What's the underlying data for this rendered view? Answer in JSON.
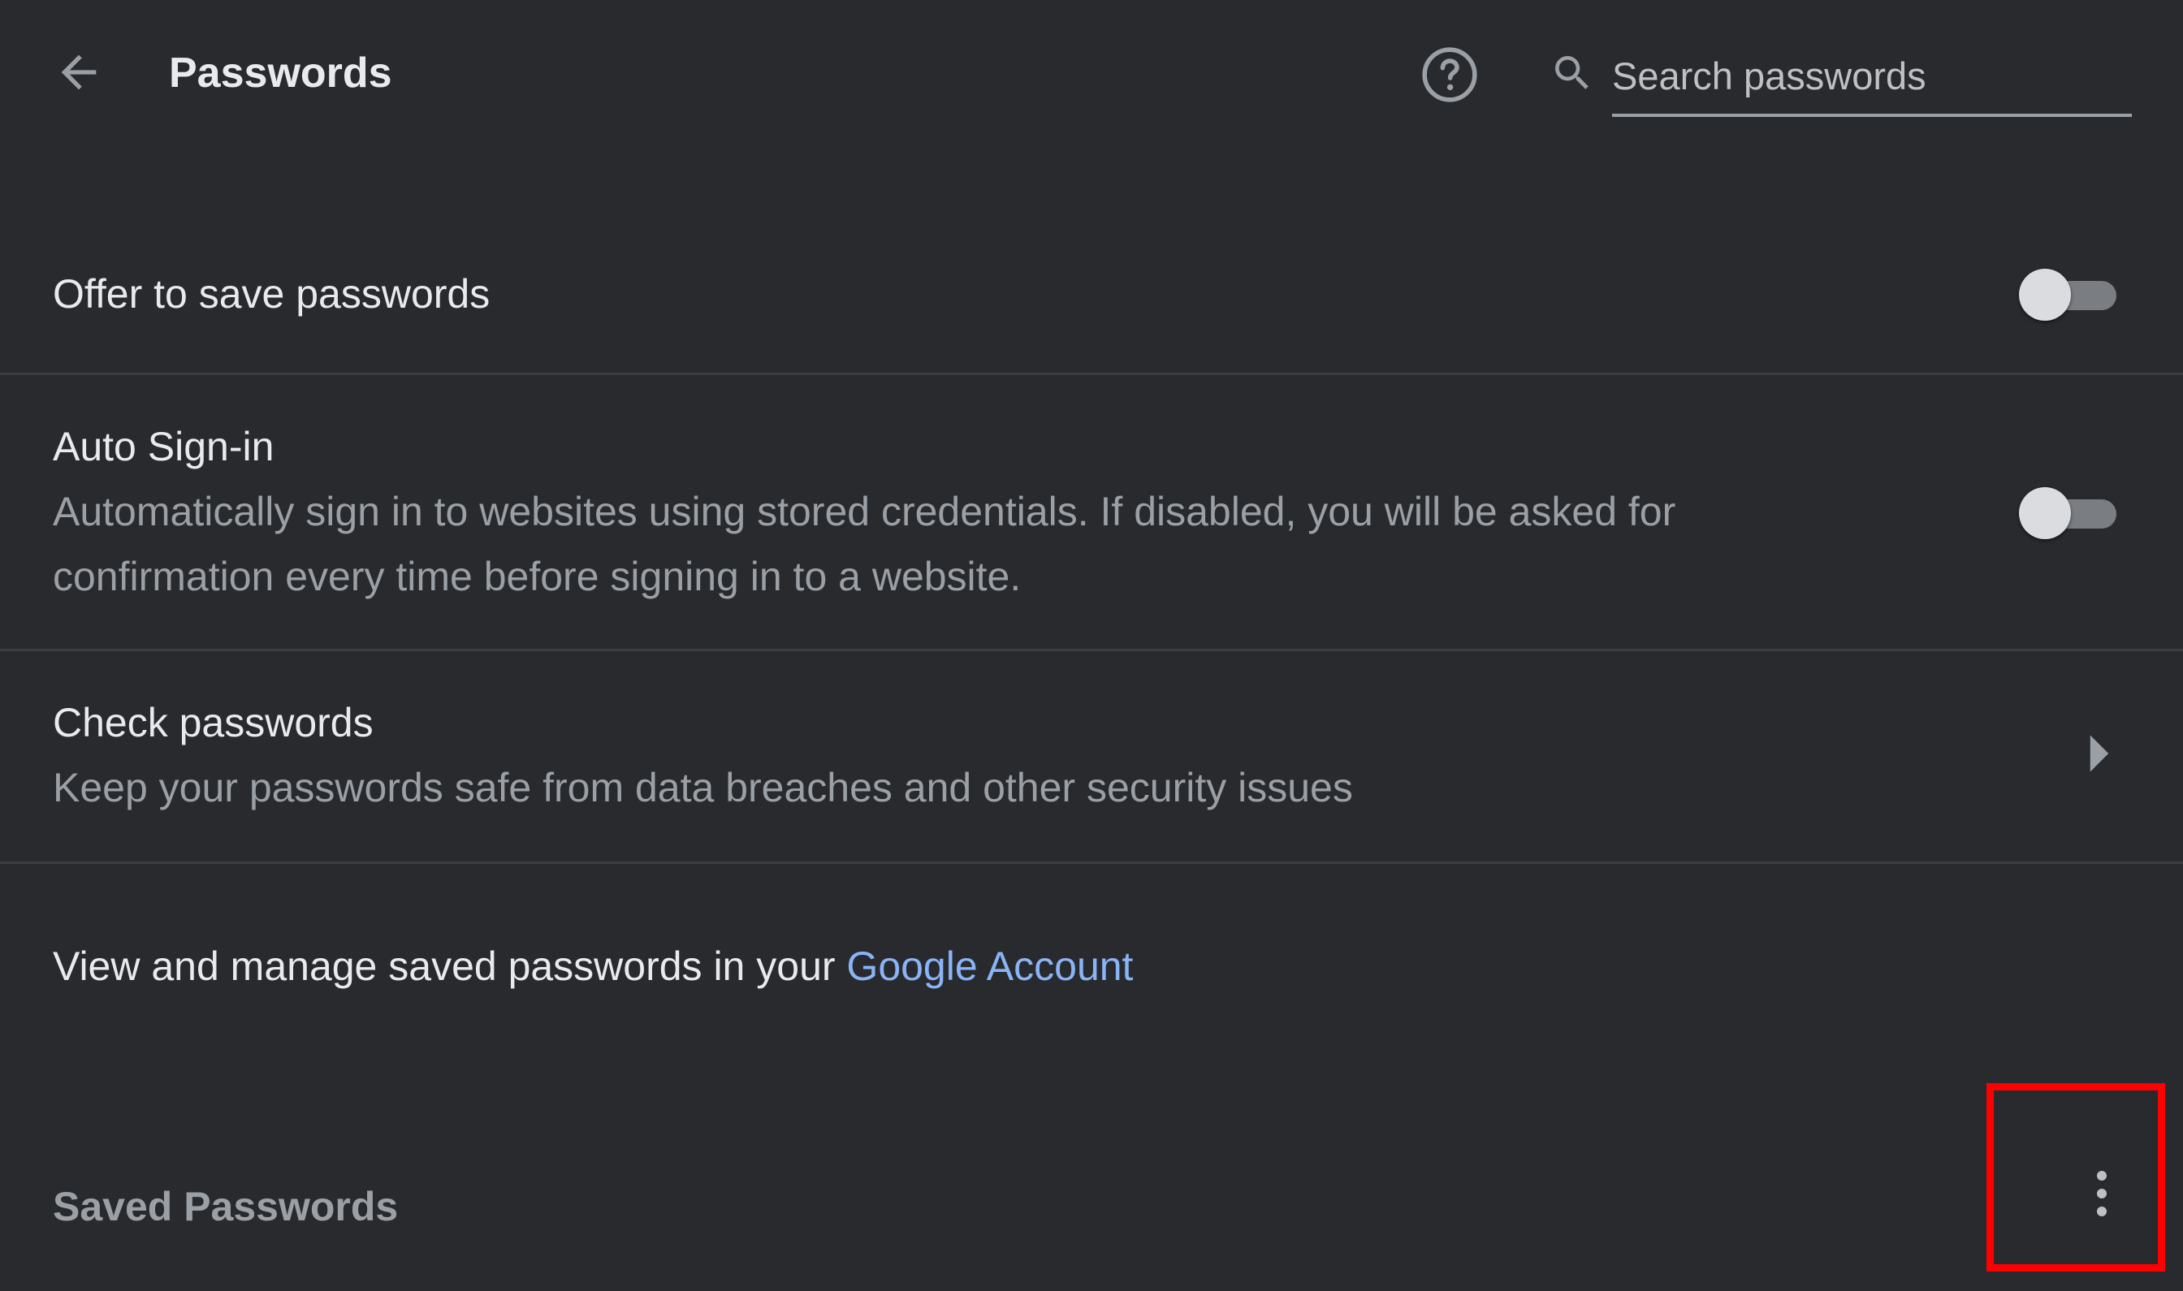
{
  "header": {
    "back_icon": "arrow-back-icon",
    "title": "Passwords",
    "help_icon": "help-circle-icon",
    "search_icon": "search-icon",
    "search_placeholder": "Search passwords"
  },
  "settings": {
    "offer_to_save": {
      "label": "Offer to save passwords",
      "enabled": false
    },
    "auto_sign_in": {
      "label": "Auto Sign-in",
      "description": "Automatically sign in to websites using stored credentials. If disabled, you will be asked for confirmation every time before signing in to a website.",
      "enabled": false
    },
    "check_passwords": {
      "label": "Check passwords",
      "description": "Keep your passwords safe from data breaches and other security issues",
      "chevron_icon": "chevron-right-icon"
    },
    "google_account": {
      "text": "View and manage saved passwords in your ",
      "link_text": "Google Account"
    }
  },
  "saved_passwords": {
    "title": "Saved Passwords",
    "more_icon": "more-vert-icon"
  },
  "colors": {
    "background": "#292a2d",
    "primary_text": "#e8eaed",
    "secondary_text": "#9aa0a6",
    "link": "#8ab4f8",
    "highlight": "#ff0000"
  }
}
